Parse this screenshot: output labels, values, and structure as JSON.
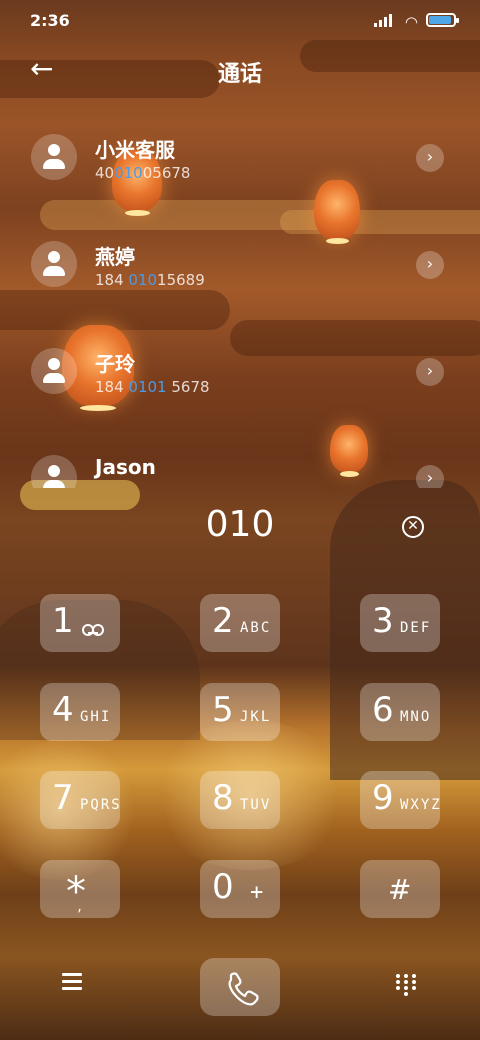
{
  "status_bar": {
    "time": "2:36"
  },
  "header": {
    "title": "通话"
  },
  "contacts": [
    {
      "name": "小米客服",
      "number_pre": "40",
      "number_hl": "010",
      "number_post": "05678"
    },
    {
      "name": "燕婷",
      "number_pre": "184 ",
      "number_hl": "010",
      "number_post": "15689"
    },
    {
      "name": "子玲",
      "number_pre": "184 ",
      "number_hl": "0101",
      "number_post": " 5678"
    },
    {
      "name": "Jason",
      "number_pre": "",
      "number_hl": "",
      "number_post": ""
    }
  ],
  "dialer": {
    "number": "010"
  },
  "keypad": [
    {
      "digit": "1",
      "letters": "",
      "voicemail": true
    },
    {
      "digit": "2",
      "letters": "ABC"
    },
    {
      "digit": "3",
      "letters": "DEF"
    },
    {
      "digit": "4",
      "letters": "GHI"
    },
    {
      "digit": "5",
      "letters": "JKL"
    },
    {
      "digit": "6",
      "letters": "MNO"
    },
    {
      "digit": "7",
      "letters": "PQRS"
    },
    {
      "digit": "8",
      "letters": "TUV"
    },
    {
      "digit": "9",
      "letters": "WXYZ"
    },
    {
      "digit": "*",
      "letters": ","
    },
    {
      "digit": "0",
      "letters": "+"
    },
    {
      "digit": "#",
      "letters": ""
    }
  ],
  "icons": {
    "back": "arrow-left-icon",
    "chevron": "chevron-right-icon",
    "delete": "delete-icon",
    "menu": "menu-icon",
    "call": "phone-icon",
    "dialpad": "dialpad-icon"
  },
  "colors": {
    "highlight": "#4a9be8",
    "battery": "#4fa7e8"
  }
}
